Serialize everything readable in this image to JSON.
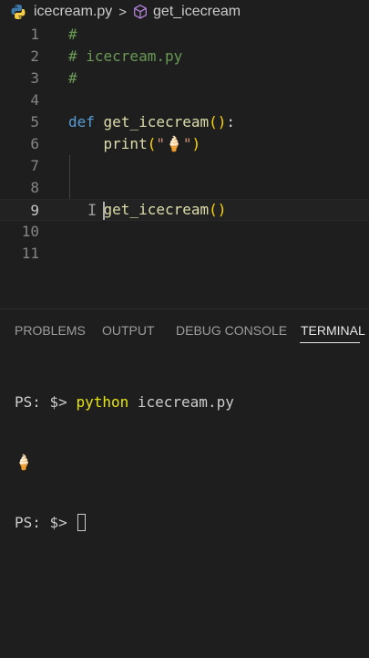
{
  "breadcrumb": {
    "file": "icecream.py",
    "separator": ">",
    "symbol": "get_icecream"
  },
  "editor": {
    "lines": [
      {
        "n": "1",
        "text": "#"
      },
      {
        "n": "2",
        "text": "# icecream.py"
      },
      {
        "n": "3",
        "text": "#"
      },
      {
        "n": "4",
        "text": ""
      },
      {
        "n": "5",
        "kw": "def",
        "fn": "get_icecream",
        "paren": "()",
        "colon": ":"
      },
      {
        "n": "6",
        "fn": "print",
        "open": "(",
        "str": "\"🍦\"",
        "close": ")"
      },
      {
        "n": "7",
        "text": ""
      },
      {
        "n": "8",
        "text": ""
      },
      {
        "n": "9",
        "fn": "get_icecream",
        "paren": "()"
      },
      {
        "n": "10",
        "text": ""
      },
      {
        "n": "11",
        "text": ""
      }
    ],
    "current_line": "9"
  },
  "panel": {
    "tabs": [
      "PROBLEMS",
      "OUTPUT",
      "DEBUG CONSOLE",
      "TERMINAL"
    ],
    "active_tab": "TERMINAL"
  },
  "terminal": {
    "prompt": "PS: $>",
    "command": "python",
    "argument": "icecream.py",
    "output": "🍦",
    "prompt2": "PS: $>"
  },
  "colors": {
    "background": "#1e1e1e",
    "comment": "#6a9955",
    "keyword": "#569cd6",
    "function": "#dcdcaa",
    "bracket": "#ffd700",
    "command": "#e5e510"
  },
  "icons": [
    "python-icon",
    "symbol-method-icon",
    "chevron-right-icon"
  ]
}
